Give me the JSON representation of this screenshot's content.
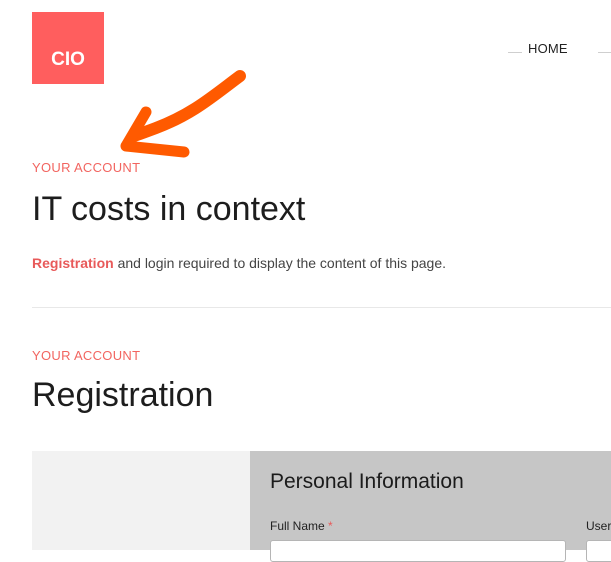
{
  "header": {
    "logo_text": "CIO",
    "nav": {
      "home_label": "HOME"
    }
  },
  "annotation": {
    "arrow_color": "#ff5a00"
  },
  "section_context": {
    "eyebrow": "YOUR ACCOUNT",
    "title": "IT costs in context",
    "notice_link": "Registration",
    "notice_text": " and login required to display the content of this page."
  },
  "section_registration": {
    "eyebrow": "YOUR ACCOUNT",
    "title": "Registration",
    "form": {
      "heading": "Personal Information",
      "full_name_label": "Full Name",
      "required_marker": "*",
      "username_label": "User"
    }
  },
  "colors": {
    "brand": "#ff5e5e",
    "accent_text": "#f26560",
    "panel_bg": "#c6c6c6"
  }
}
